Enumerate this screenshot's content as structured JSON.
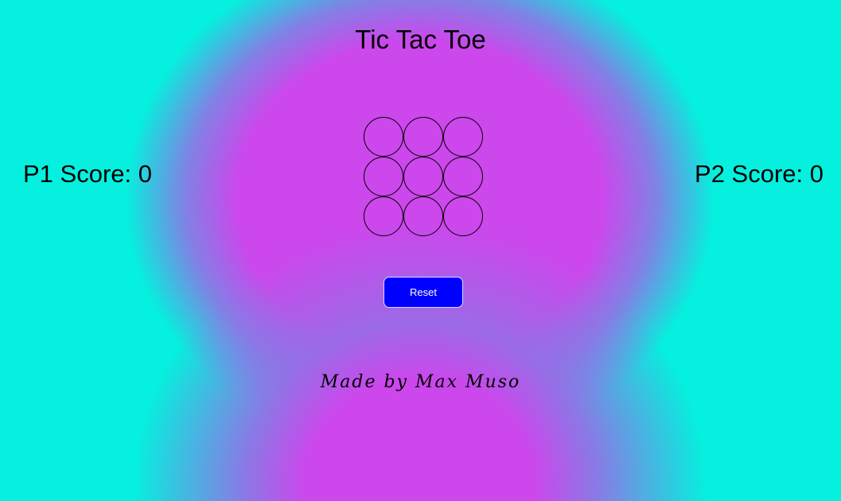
{
  "header": {
    "title": "Tic Tac Toe"
  },
  "scores": {
    "p1_label": "P1 Score: 0",
    "p2_label": "P2 Score: 0",
    "p1": 0,
    "p2": 0
  },
  "board": {
    "cells": [
      "",
      "",
      "",
      "",
      "",
      "",
      "",
      "",
      ""
    ]
  },
  "controls": {
    "reset_label": "Reset"
  },
  "footer": {
    "credit": "Made by Max Muso"
  },
  "colors": {
    "background_outer": "#05f0de",
    "background_inner": "#cc47ec",
    "reset_button": "#0000ff"
  }
}
